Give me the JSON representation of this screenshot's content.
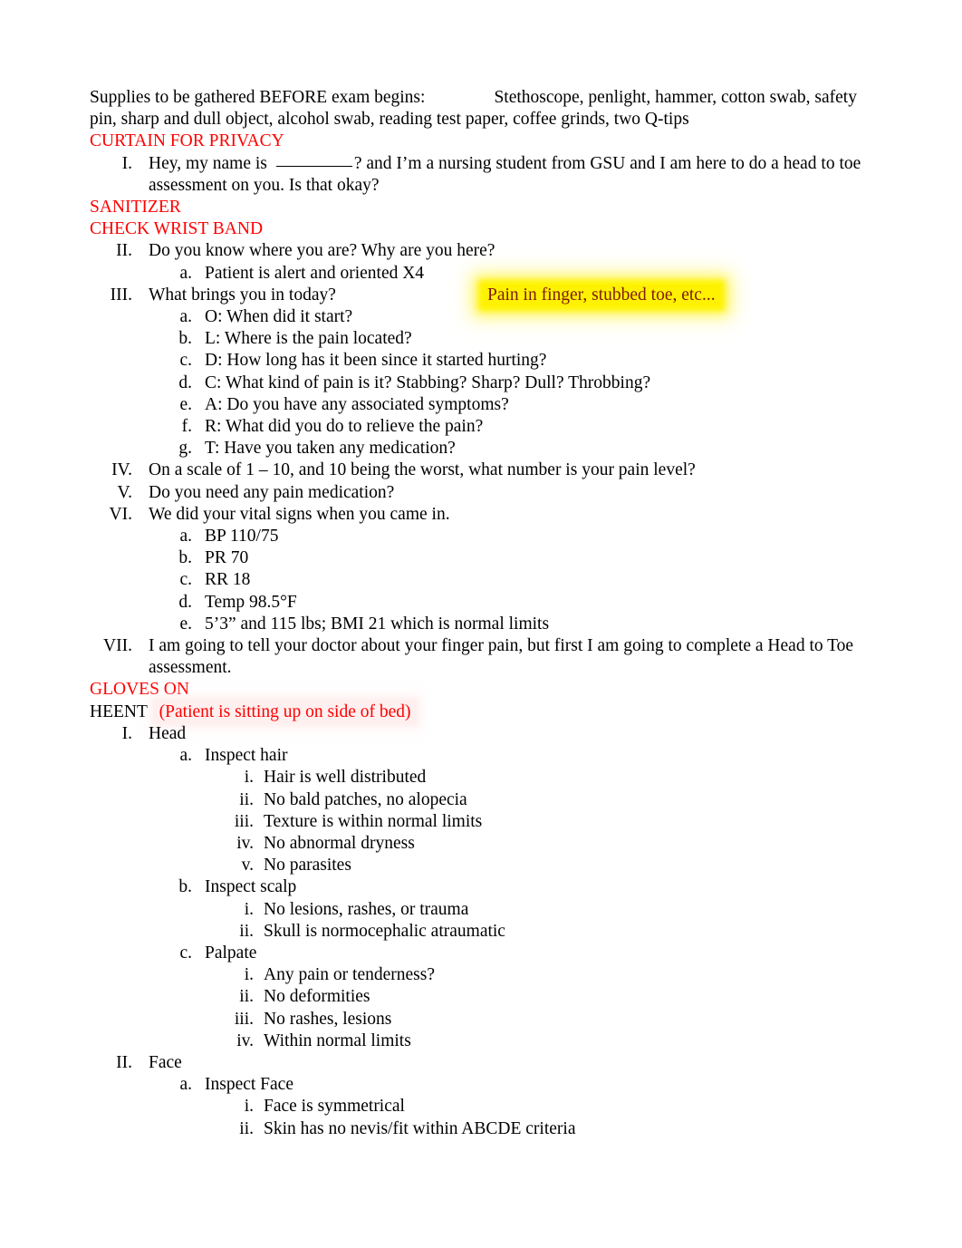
{
  "document": {
    "supplies": {
      "label": "Supplies to be gathered BEFORE exam begins:",
      "items": "Stethoscope, penlight, hammer, cotton swab, safety pin, sharp and dull object, alcohol swab, reading test paper, coffee grinds, two Q-tips"
    },
    "cues": {
      "curtain": "CURTAIN FOR PRIVACY",
      "sanitizer": "SANITIZER",
      "wristband": "CHECK WRIST BAND",
      "gloves": "GLOVES ON"
    },
    "intro": {
      "marker": "I.",
      "text_before_blank": "Hey, my name is",
      "text_after_blank": "?   and I’m a nursing student from GSU and I am here to do a head to toe assessment on you. Is that okay?"
    },
    "orientation": {
      "marker": "II.",
      "question": "Do you know where you are? Why are you here?",
      "sub": [
        {
          "marker": "a.",
          "text": "Patient is alert and oriented X4"
        }
      ]
    },
    "chief_complaint": {
      "marker": "III.",
      "question": "What brings you in today?",
      "highlight_note": "Pain in finger, stubbed toe, etc...",
      "oldcart": [
        {
          "marker": "a.",
          "text": "O: When did it start?"
        },
        {
          "marker": "b.",
          "text": "L: Where is the pain located?"
        },
        {
          "marker": "c.",
          "text": "D: How long has it been since it started hurting?"
        },
        {
          "marker": "d.",
          "text": "C: What kind of pain is it? Stabbing? Sharp? Dull? Throbbing?"
        },
        {
          "marker": "e.",
          "text": "A: Do you have any associated symptoms?"
        },
        {
          "marker": "f.",
          "text": "R: What did you do to relieve the pain?"
        },
        {
          "marker": "g.",
          "text": "T: Have you taken any medication?"
        }
      ]
    },
    "pain_scale": {
      "marker": "IV.",
      "text": "On a scale of 1 – 10, and 10 being the worst, what number is your pain level?"
    },
    "pain_meds": {
      "marker": "V.",
      "text": "Do you need any pain medication?"
    },
    "vitals": {
      "marker": "VI.",
      "text": "We did your vital signs when you came in.",
      "items": [
        {
          "marker": "a.",
          "text": "BP 110/75"
        },
        {
          "marker": "b.",
          "text": "PR 70"
        },
        {
          "marker": "c.",
          "text": "RR 18"
        },
        {
          "marker": "d.",
          "text": "Temp 98.5°F"
        },
        {
          "marker": "e.",
          "text": "5’3” and 115 lbs; BMI 21 which is normal limits"
        }
      ]
    },
    "closing": {
      "marker": "VII.",
      "text": "I am going to tell your doctor about your finger pain, but first I am going to complete a Head to Toe assessment."
    },
    "heent": {
      "title": "HEENT",
      "note": "(Patient is sitting up on side of bed)",
      "sections": [
        {
          "marker": "I.",
          "title": "Head",
          "subsections": [
            {
              "marker": "a.",
              "title": "Inspect hair",
              "points": [
                {
                  "marker": "i.",
                  "text": "Hair is well distributed"
                },
                {
                  "marker": "ii.",
                  "text": "No bald patches, no alopecia"
                },
                {
                  "marker": "iii.",
                  "text": "Texture is within normal limits"
                },
                {
                  "marker": "iv.",
                  "text": "No abnormal dryness"
                },
                {
                  "marker": "v.",
                  "text": "No parasites"
                }
              ]
            },
            {
              "marker": "b.",
              "title": "Inspect scalp",
              "points": [
                {
                  "marker": "i.",
                  "text": "No lesions, rashes, or trauma"
                },
                {
                  "marker": "ii.",
                  "text": "Skull is normocephalic atraumatic"
                }
              ]
            },
            {
              "marker": "c.",
              "title": "Palpate",
              "points": [
                {
                  "marker": "i.",
                  "text": "Any pain or tenderness?"
                },
                {
                  "marker": "ii.",
                  "text": "No deformities"
                },
                {
                  "marker": "iii.",
                  "text": "No rashes, lesions"
                },
                {
                  "marker": "iv.",
                  "text": "Within normal limits"
                }
              ]
            }
          ]
        },
        {
          "marker": "II.",
          "title": "Face",
          "subsections": [
            {
              "marker": "a.",
              "title": "Inspect Face",
              "points": [
                {
                  "marker": "i.",
                  "text": "Face is symmetrical"
                },
                {
                  "marker": "ii.",
                  "text": "Skin has no nevis/fit within ABCDE criteria"
                }
              ]
            }
          ]
        }
      ]
    }
  },
  "colors": {
    "red_cue": "#ff0000",
    "highlight_yellow": "#fff200",
    "highlight_text": "#7e1b0b",
    "body_text": "#000000"
  }
}
